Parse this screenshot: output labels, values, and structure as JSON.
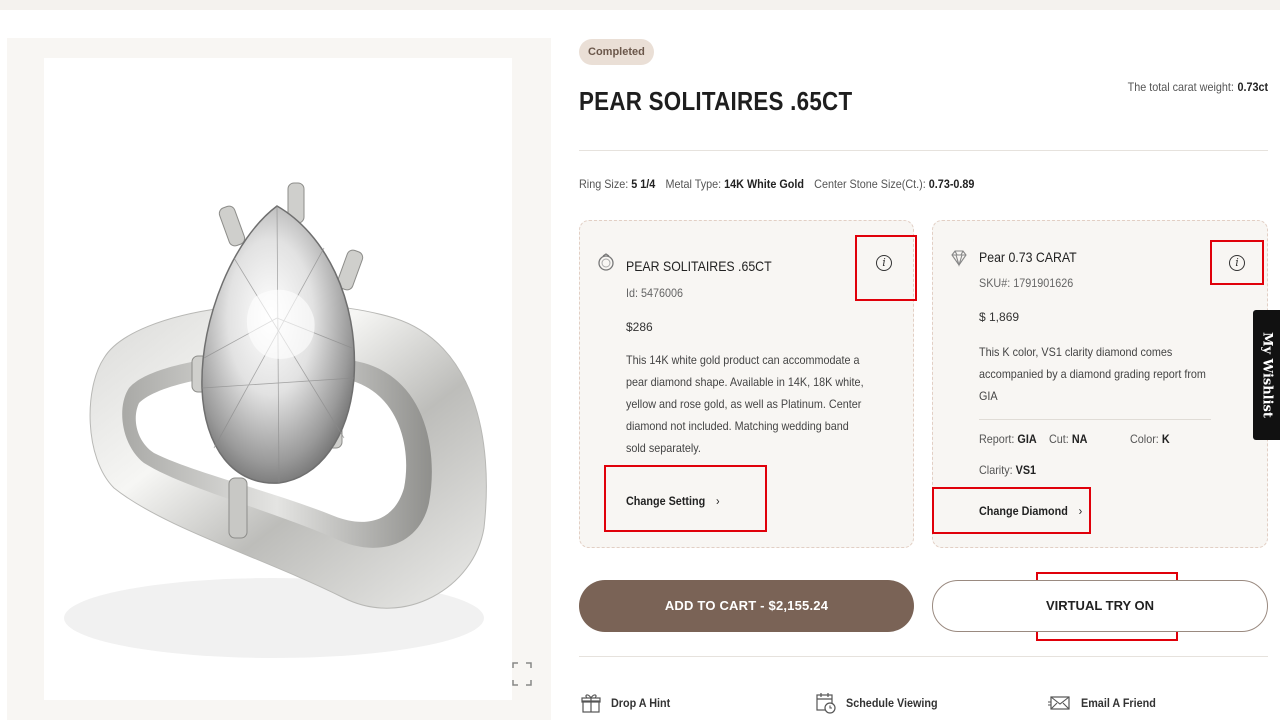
{
  "status_badge": "Completed",
  "product": {
    "title": "PEAR SOLITAIRES .65CT",
    "total_carat_label": "The total carat weight:",
    "total_carat_value": "0.73ct"
  },
  "specs": {
    "ring_size_label": "Ring Size:",
    "ring_size_value": "5 1/4",
    "metal_label": "Metal Type:",
    "metal_value": "14K White Gold",
    "stone_label": "Center Stone Size(Ct.):",
    "stone_value": "0.73-0.89"
  },
  "setting_card": {
    "name": "PEAR SOLITAIRES .65CT",
    "id_text": "Id: 5476006",
    "price": "$286",
    "description": "This 14K white gold product can accommodate a pear diamond shape. Available in 14K, 18K white, yellow and rose gold, as well as Platinum. Center diamond not included. Matching wedding band sold separately.",
    "change_label": "Change Setting",
    "info_glyph": "i",
    "icon": "ring-icon"
  },
  "diamond_card": {
    "name": "Pear 0.73 CARAT",
    "sku_text": "SKU#: 1791901626",
    "price": "$ 1,869",
    "description": "This K color, VS1 clarity diamond comes accompanied by a diamond grading report from GIA",
    "report_label": "Report:",
    "report_value": "GIA",
    "cut_label": "Cut:",
    "cut_value": "NA",
    "color_label": "Color:",
    "color_value": "K",
    "clarity_label": "Clarity:",
    "clarity_value": "VS1",
    "change_label": "Change Diamond",
    "info_glyph": "i",
    "icon": "diamond-icon"
  },
  "buttons": {
    "add_to_cart": "ADD TO CART - $2,155.24",
    "virtual_try_on": "VIRTUAL TRY ON"
  },
  "actions": [
    {
      "label": "Drop A Hint",
      "icon": "gift-icon"
    },
    {
      "label": "Schedule Viewing",
      "icon": "calendar-clock-icon"
    },
    {
      "label": "Email A Friend",
      "icon": "envelope-icon"
    }
  ],
  "wishlist_tab": "My Wishlist",
  "chevron": "›",
  "colors": {
    "accent": "#7a6356",
    "highlight": "#e0000a",
    "badge_bg": "#eadfd6",
    "card_bg": "#f8f6f3"
  }
}
